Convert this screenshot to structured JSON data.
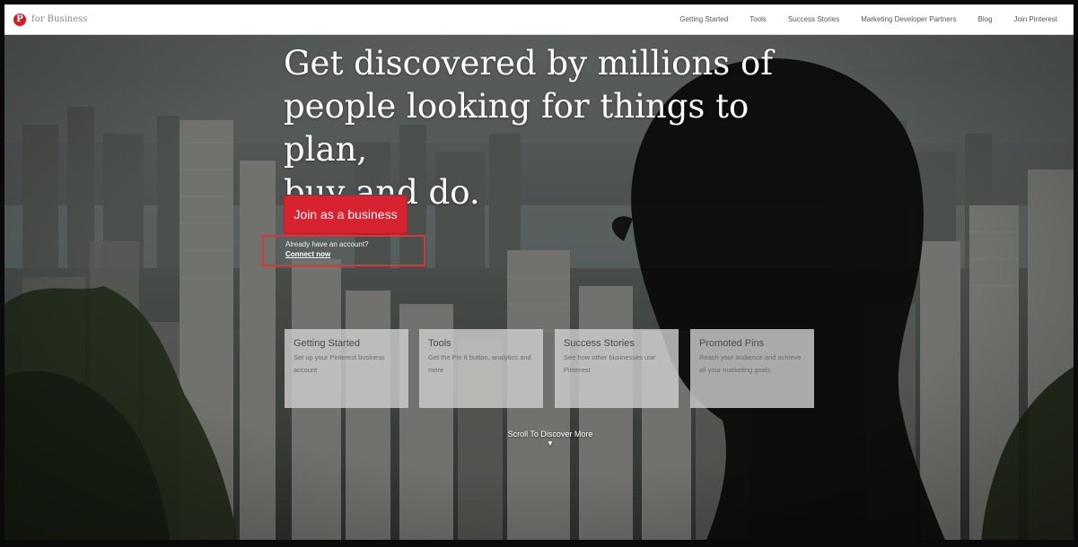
{
  "nav": {
    "brand": "for Business",
    "logo_glyph": "P",
    "links": [
      "Getting Started",
      "Tools",
      "Success Stories",
      "Marketing Developer Partners",
      "Blog",
      "Join Pinterest"
    ]
  },
  "hero": {
    "headline_lines": [
      "Get discovered by millions of",
      "people looking for things to plan,",
      "buy and do."
    ],
    "cta_label": "Join as a business",
    "signin_question": "Already have an account?",
    "signin_link": "Connect now",
    "scroll_label": "Scroll To Discover More",
    "scroll_icon": "chevron-down-icon"
  },
  "cards": [
    {
      "title": "Getting Started",
      "desc": "Set up your Pinterest business account"
    },
    {
      "title": "Tools",
      "desc": "Get the Pin It button, analytics and more"
    },
    {
      "title": "Success Stories",
      "desc": "See how other businesses use Pinterest"
    },
    {
      "title": "Promoted Pins",
      "desc": "Reach your audience and achieve all your marketing goals"
    }
  ],
  "colors": {
    "brand_red": "#cb2027",
    "cta_red": "#d7232f",
    "highlight_outline": "#d23a3a"
  }
}
